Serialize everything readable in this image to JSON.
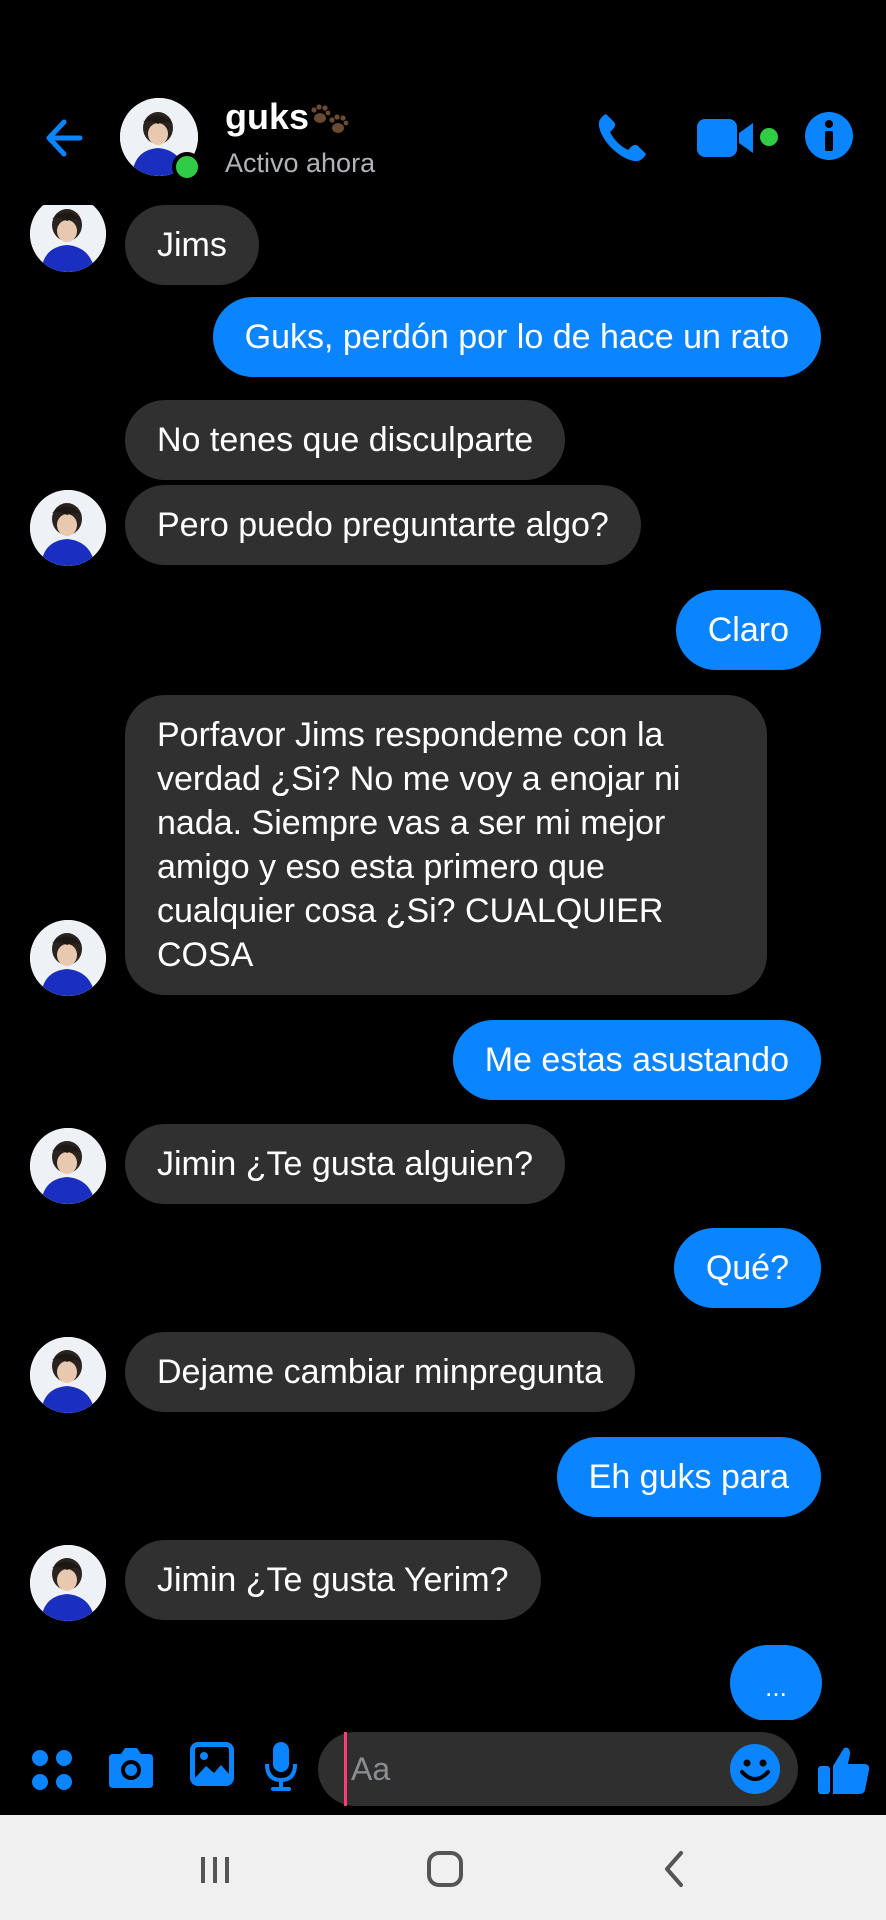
{
  "header": {
    "name": "guks",
    "status": "Activo ahora"
  },
  "colors": {
    "accent": "#0a84ff",
    "incoming_bubble": "#303030",
    "online": "#31cc46",
    "background": "#000000"
  },
  "messages": [
    {
      "from": "them",
      "text": "Jims"
    },
    {
      "from": "me",
      "text": "Guks, perdón  por lo de hace un rato"
    },
    {
      "from": "them",
      "text": "No tenes que disculparte"
    },
    {
      "from": "them",
      "text": "Pero puedo preguntarte algo?"
    },
    {
      "from": "me",
      "text": "Claro"
    },
    {
      "from": "them",
      "lines": [
        "Porfavor Jims respondeme con la",
        "verdad ¿Si? No me voy a enojar ni",
        "nada. Siempre vas a ser mi mejor",
        "amigo y eso esta primero que",
        "cualquier cosa ¿Si? CUALQUIER",
        "COSA"
      ]
    },
    {
      "from": "me",
      "text": "Me estas asustando"
    },
    {
      "from": "them",
      "text": "Jimin ¿Te gusta alguien?"
    },
    {
      "from": "me",
      "text": "Qué?"
    },
    {
      "from": "them",
      "text": "Dejame cambiar minpregunta"
    },
    {
      "from": "me",
      "text": "Eh guks para"
    },
    {
      "from": "them",
      "text": "Jimin ¿Te gusta Yerim?"
    },
    {
      "from": "me",
      "text": "..."
    }
  ],
  "composer": {
    "placeholder": "Aa"
  },
  "icons": [
    "back-arrow-icon",
    "phone-icon",
    "video-camera-icon",
    "info-icon",
    "apps-icon",
    "camera-icon",
    "gallery-icon",
    "mic-icon",
    "emoji-icon",
    "like-icon",
    "recent-apps-icon",
    "home-icon",
    "nav-back-icon"
  ]
}
